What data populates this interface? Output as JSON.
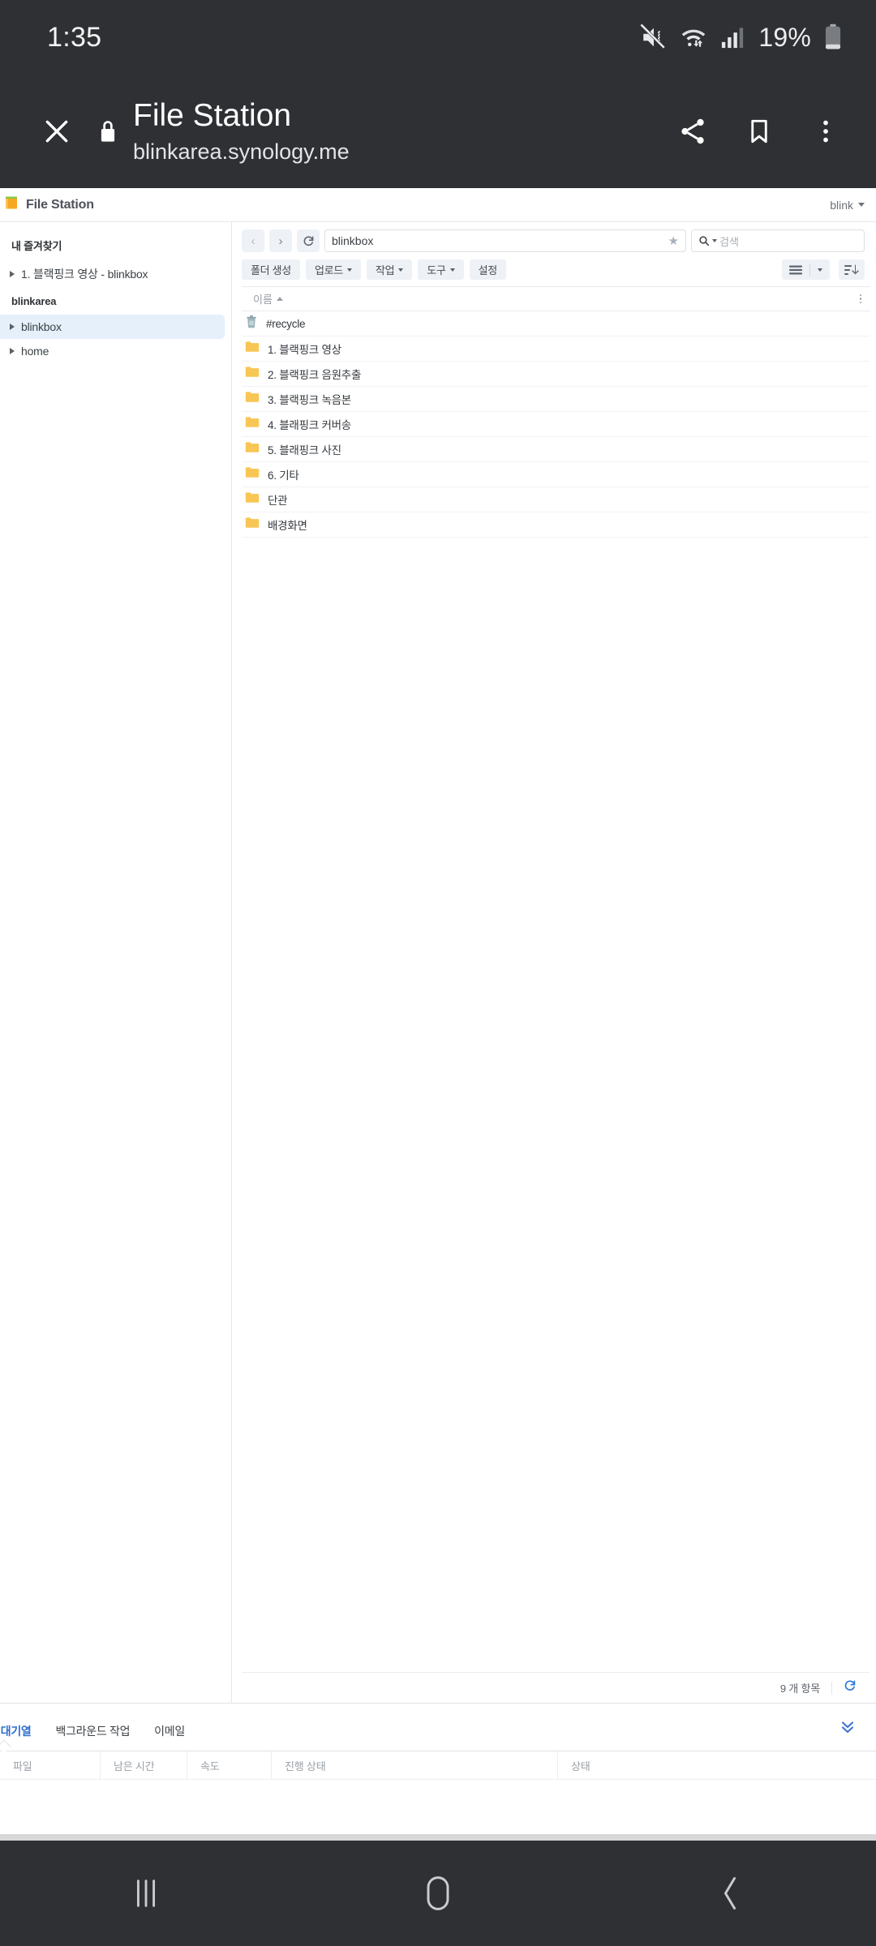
{
  "status_bar": {
    "time": "1:35",
    "battery_percent": "19%",
    "icons": [
      "mute-vibrate-icon",
      "wifi-icon",
      "cellular-signal-icon",
      "battery-icon"
    ]
  },
  "browser_bar": {
    "close_label": "✕",
    "security_icon": "lock-icon",
    "title": "File Station",
    "url": "blinkarea.synology.me",
    "actions": [
      "share-icon",
      "bookmark-icon",
      "overflow-menu-icon"
    ]
  },
  "app_header": {
    "icon": "file-station-folder-icon",
    "title": "File Station",
    "user": "blink"
  },
  "sidebar": {
    "groups": [
      {
        "label": "내 즐겨찾기",
        "items": [
          {
            "label": "1. 블랙핑크 영상 - blinkbox",
            "selected": false
          }
        ]
      },
      {
        "label": "blinkarea",
        "items": [
          {
            "label": "blinkbox",
            "selected": true
          },
          {
            "label": "home",
            "selected": false
          }
        ]
      }
    ]
  },
  "path_row": {
    "back_label": "‹",
    "forward_label": "›",
    "refresh_icon": "refresh-icon",
    "path_value": "blinkbox",
    "star_icon": "star-icon",
    "search_icon": "search-icon",
    "search_placeholder": "검색"
  },
  "toolbar": {
    "buttons": [
      {
        "label": "폴더 생성",
        "has_caret": false
      },
      {
        "label": "업로드",
        "has_caret": true
      },
      {
        "label": "작업",
        "has_caret": true
      },
      {
        "label": "도구",
        "has_caret": true
      },
      {
        "label": "설정",
        "has_caret": false
      }
    ],
    "view_mode_icon": "list-view-icon",
    "view_mode_caret": "chevron-down-icon",
    "sort_icon": "sort-descending-icon"
  },
  "file_list": {
    "column_header": "이름",
    "sort_direction": "asc",
    "rows": [
      {
        "name": "#recycle",
        "icon": "trash-icon"
      },
      {
        "name": "1. 블랙핑크 영상",
        "icon": "folder-icon"
      },
      {
        "name": "2. 블랙핑크 음원추출",
        "icon": "folder-icon"
      },
      {
        "name": "3. 블랙핑크 녹음본",
        "icon": "folder-icon"
      },
      {
        "name": "4. 블래핑크 커버송",
        "icon": "folder-icon"
      },
      {
        "name": "5. 블래핑크 사진",
        "icon": "folder-icon"
      },
      {
        "name": "6. 기타",
        "icon": "folder-icon"
      },
      {
        "name": "단관",
        "icon": "folder-icon"
      },
      {
        "name": "배경화면",
        "icon": "folder-icon"
      }
    ],
    "footer_count": "9 개 항목",
    "footer_refresh_icon": "refresh-icon"
  },
  "bottom_panel": {
    "tabs": [
      {
        "label": "로드 대기열",
        "active": true
      },
      {
        "label": "백그라운드 작업",
        "active": false
      },
      {
        "label": "이메일",
        "active": false
      }
    ],
    "collapse_icon": "double-chevron-down-icon",
    "columns": [
      "파일",
      "남은 시간",
      "속도",
      "진행 상태",
      "상태"
    ]
  },
  "nav_bar": {
    "recents": "recents-icon",
    "home": "home-icon",
    "back": "back-icon"
  },
  "colors": {
    "chrome_dark": "#2e3034",
    "accent_blue": "#2f6fd0",
    "folder_yellow": "#f5c146",
    "selected_row": "#e5f0fb"
  }
}
